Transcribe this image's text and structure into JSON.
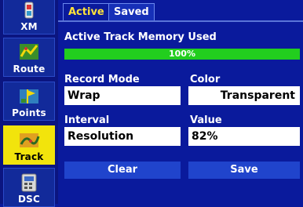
{
  "sidebar": {
    "items": [
      {
        "label": "XM",
        "icon": "xm-icon"
      },
      {
        "label": "Route",
        "icon": "route-icon"
      },
      {
        "label": "Points",
        "icon": "points-icon"
      },
      {
        "label": "Track",
        "icon": "track-icon",
        "selected": true
      },
      {
        "label": "DSC",
        "icon": "dsc-icon"
      }
    ]
  },
  "tabs": [
    {
      "label": "Active",
      "active": true
    },
    {
      "label": "Saved",
      "active": false
    }
  ],
  "memory": {
    "label": "Active Track Memory Used",
    "percent_text": "100%",
    "fraction": 1.0
  },
  "record_mode": {
    "label": "Record Mode",
    "value": "Wrap"
  },
  "color": {
    "label": "Color",
    "value": "Transparent"
  },
  "interval": {
    "label": "Interval",
    "value": "Resolution"
  },
  "interval_value": {
    "label": "Value",
    "value": "82%"
  },
  "buttons": {
    "clear": "Clear",
    "save": "Save"
  },
  "colors": {
    "background": "#0a1a9c",
    "selected": "#f2e40c",
    "progress": "#22ce1e",
    "active_tab_text": "#ffe23a"
  }
}
